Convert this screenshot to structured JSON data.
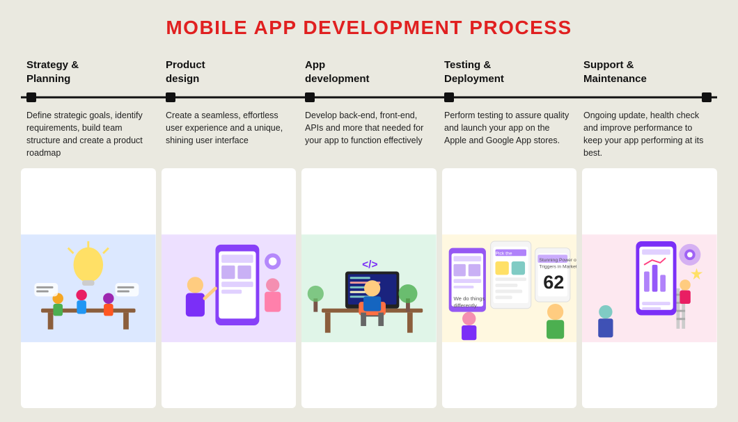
{
  "page": {
    "title": "MOBILE APP DEVELOPMENT PROCESS",
    "background_color": "#eae9e0"
  },
  "steps": [
    {
      "id": "strategy",
      "header": "Strategy &\nPlanning",
      "description": "Define strategic goals, identify requirements, build team structure and create a product roadmap",
      "image_label": "strategy-illustration",
      "image_bg": "#dce8ff"
    },
    {
      "id": "product",
      "header": "Product\ndesign",
      "description": "Create a seamless, effortless user experience and a unique, shining user interface",
      "image_label": "product-illustration",
      "image_bg": "#e4d8ff"
    },
    {
      "id": "app",
      "header": "App\ndevelopment",
      "description": "Develop back-end, front-end, APIs and more that needed for your app to function effectively",
      "image_label": "app-illustration",
      "image_bg": "#d8f5e8"
    },
    {
      "id": "testing",
      "header": "Testing &\nDeployment",
      "description": "Perform testing to assure quality and launch your app on the Apple and Google App stores.",
      "image_label": "testing-illustration",
      "image_bg": "#fff0cc"
    },
    {
      "id": "support",
      "header": "Support &\nMaintenance",
      "description": "Ongoing update, health check and improve performance to keep your app performing at its best.",
      "image_label": "support-illustration",
      "image_bg": "#ffd8e8"
    }
  ]
}
